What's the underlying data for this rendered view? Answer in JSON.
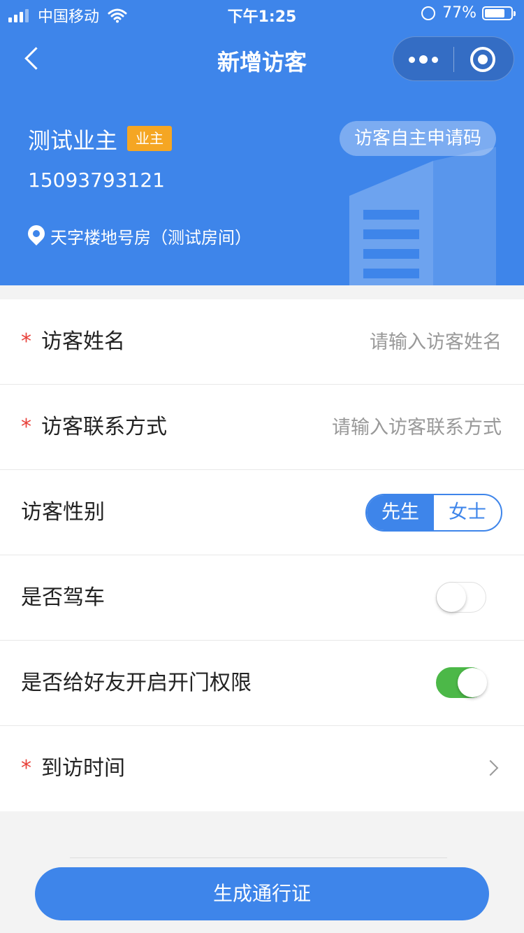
{
  "status_bar": {
    "carrier": "中国移动",
    "time": "下午1:25",
    "battery": "77%"
  },
  "nav": {
    "title": "新增访客"
  },
  "owner": {
    "name": "测试业主",
    "tag": "业主",
    "phone": "15093793121",
    "address": "天字楼地号房（测试房间）",
    "apply_code_label": "访客自主申请码"
  },
  "form": {
    "visitor_name": {
      "label": "访客姓名",
      "required_mark": "*",
      "placeholder": "请输入访客姓名"
    },
    "visitor_contact": {
      "label": "访客联系方式",
      "required_mark": "*",
      "placeholder": "请输入访客联系方式"
    },
    "visitor_gender": {
      "label": "访客性别",
      "options": [
        "先生",
        "女士"
      ],
      "selected": "先生"
    },
    "driving": {
      "label": "是否驾车",
      "on": false
    },
    "door_permission": {
      "label": "是否给好友开启开门权限",
      "on": true
    },
    "visit_time": {
      "label": "到访时间",
      "required_mark": "*"
    }
  },
  "submit_label": "生成通行证",
  "colors": {
    "primary": "#3e85ea",
    "tag": "#f5a623",
    "required": "#e8413a",
    "switch_on": "#4cb848"
  }
}
